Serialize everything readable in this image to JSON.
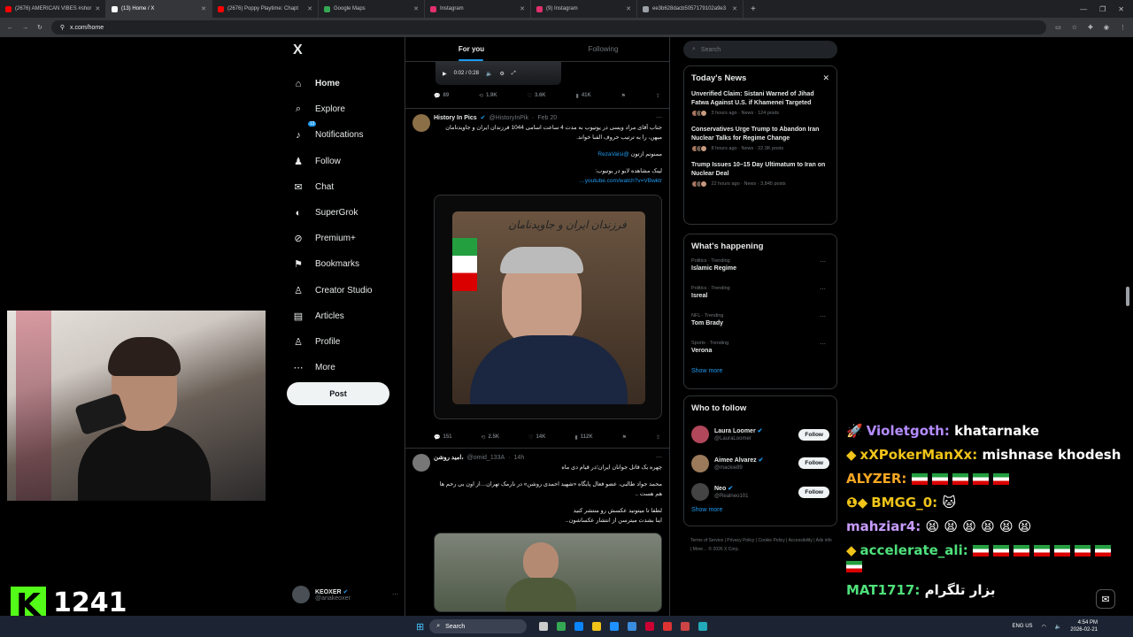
{
  "browser": {
    "tabs": [
      {
        "title": "(2676) AMERICAN VIBES #shor",
        "color": "#ff0000"
      },
      {
        "title": "(13) Home / X",
        "color": "#ffffff"
      },
      {
        "title": "(2676) Poppy Playtime: Chapt",
        "color": "#ff0000"
      },
      {
        "title": "Google Maps",
        "color": "#34a853"
      },
      {
        "title": "Instagram",
        "color": "#e1306c"
      },
      {
        "title": "(9) Instagram",
        "color": "#e1306c"
      },
      {
        "title": "ee3b628dacb5057179102a9e3",
        "color": "#9aa0a6"
      }
    ],
    "url": "x.com/home"
  },
  "nav": {
    "logo": "X",
    "items": [
      {
        "label": "Home",
        "icon": "⌂"
      },
      {
        "label": "Explore",
        "icon": "⌕"
      },
      {
        "label": "Notifications",
        "icon": "♪",
        "badge": "13"
      },
      {
        "label": "Follow",
        "icon": "♟"
      },
      {
        "label": "Chat",
        "icon": "✉"
      },
      {
        "label": "SuperGrok",
        "icon": "◐"
      },
      {
        "label": "Premium+",
        "icon": "⊘"
      },
      {
        "label": "Bookmarks",
        "icon": "⚑"
      },
      {
        "label": "Creator Studio",
        "icon": "♙"
      },
      {
        "label": "Articles",
        "icon": "▤"
      },
      {
        "label": "Profile",
        "icon": "♙"
      },
      {
        "label": "More",
        "icon": "⋯"
      }
    ],
    "post": "Post",
    "account": {
      "name": "KEOXER",
      "handle": "@ariakeoxer"
    }
  },
  "feed": {
    "tabs": [
      "For you",
      "Following"
    ],
    "player_time": "0:02 / 0:28",
    "stats1": {
      "replies": "89",
      "reposts": "1.9K",
      "likes": "3.6K",
      "views": "41K"
    },
    "tweet1": {
      "name": "History In Pics",
      "handle": "@HistoryInPik",
      "date": "Feb 20",
      "text1": "جناب آقای مراد ویسی در یوتیوب به مدت 4 ساعت اسامی 1044 فرزندان ایران و جاویدنامان میهن، را به ترتیب حروف الفبا خواند.",
      "text2": "ممنونم ازتون",
      "mention": "@RezaVaisi",
      "text3": "لینک مشاهده لایو در یوتیوب:",
      "link": "youtube.com/watch?v=VBwktr…",
      "banner": "فرزندان ایران و جاویدنامان"
    },
    "stats2": {
      "replies": "151",
      "reposts": "2.5K",
      "likes": "14K",
      "views": "112K"
    },
    "tweet2": {
      "name": "امید روشن،",
      "handle": "@omid_133A",
      "date": "14h",
      "text1": "چهره یک  قاتل جوانان ایران؛در قیام دی ماه",
      "text2": "محمد جواد طالبی، عضو فعال پایگاه «شهید احمدی روشن» در نارمک تهران…از اون بی رحم ها هم هست ..",
      "text3": "لطفا تا میتونید عکسش رو منتشر کنید",
      "text4": "اینا بشدت میترسن از انتشار عکساشون.."
    }
  },
  "right": {
    "search_placeholder": "Search",
    "news_title": "Today's News",
    "news": [
      {
        "title": "Unverified Claim: Sistani Warned of Jihad Fatwa Against U.S. if Khamenei Targeted",
        "meta": "3 hours ago · News · 124 posts"
      },
      {
        "title": "Conservatives Urge Trump to Abandon Iran Nuclear Talks for Regime Change",
        "meta": "8 hours ago · News · 22.3K posts"
      },
      {
        "title": "Trump Issues 10–15 Day Ultimatum to Iran on Nuclear Deal",
        "meta": "22 hours ago · News · 3,845 posts"
      }
    ],
    "happening_title": "What's happening",
    "trends": [
      {
        "cat": "Politics · Trending",
        "name": "Islamic Regime"
      },
      {
        "cat": "Politics · Trending",
        "name": "Isreal"
      },
      {
        "cat": "NFL · Trending",
        "name": "Tom Brady"
      },
      {
        "cat": "Sports · Trending",
        "name": "Verona"
      }
    ],
    "show_more": "Show more",
    "wtf_title": "Who to follow",
    "follow": [
      {
        "name": "Laura Loomer",
        "handle": "@LauraLoomer",
        "color": "#b0475a"
      },
      {
        "name": "Aimee Alvarez",
        "handle": "@mackie89",
        "color": "#9a7a5a"
      },
      {
        "name": "Neo",
        "handle": "@Realneo101",
        "color": "#444"
      }
    ],
    "follow_label": "Follow",
    "footer": "Terms of Service  |  Privacy Policy  |  Cookie Policy  |  Accessibility  |  Ads info  |  More…  © 2026 X Corp."
  },
  "stream": {
    "viewers": "1241",
    "chat": [
      {
        "user": "Violetgoth:",
        "msg": "khatarnake",
        "color": "#b48cff",
        "badge": "🚀"
      },
      {
        "user": "xXPokerManXx:",
        "msg": "mishnase khodesh",
        "color": "#f0c419",
        "badge": "◆"
      },
      {
        "user": "ALYZER:",
        "msg": "",
        "color": "#f5a623",
        "flags": 5
      },
      {
        "user": "BMGG_0:",
        "msg": "🐱",
        "color": "#f0c419",
        "badge": "❶◆"
      },
      {
        "user": "mahziar4:",
        "msg": "😫 😫 😫 😫 😫 😫",
        "color": "#c79cff"
      },
      {
        "user": "accelerate_ali:",
        "msg": "",
        "color": "#4ee07a",
        "badge": "◆",
        "flags": 8
      },
      {
        "user": "MAT1717:",
        "msg": "بزار تلگرام",
        "color": "#4ee07a"
      }
    ]
  },
  "taskbar": {
    "search": "Search",
    "lang": "ENG US",
    "time": "4:54 PM",
    "date": "2026-02-21"
  }
}
